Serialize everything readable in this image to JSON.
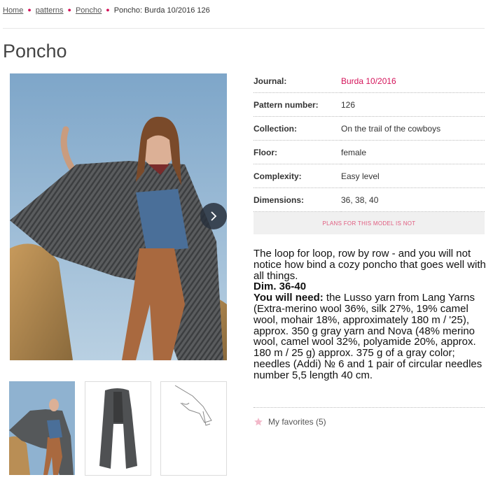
{
  "breadcrumb": {
    "home": "Home",
    "patterns": "patterns",
    "category": "Poncho",
    "current": "Poncho: Burda 10/2016 126"
  },
  "page": {
    "title": "Poncho"
  },
  "details": {
    "journal_label": "Journal:",
    "journal_value": "Burda 10/2016",
    "pattern_label": "Pattern number:",
    "pattern_value": "126",
    "collection_label": "Collection:",
    "collection_value": "On the trail of the cowboys",
    "floor_label": "Floor:",
    "floor_value": "female",
    "complexity_label": "Complexity:",
    "complexity_value": "Easy level",
    "dimensions_label": "Dimensions:",
    "dimensions_value": "36, 38, 40"
  },
  "plans_button": "PLANS FOR THIS MODEL IS NOT",
  "description": {
    "intro": "The loop for loop, row by row - and you will not notice how bind a cozy poncho that goes well with all things.",
    "dim": "Dim. 36-40",
    "need_label": "You will need:",
    "need_text": " the Lusso yarn from Lang Yarns (Extra-merino wool 36%, silk 27%, 19% camel wool, mohair 18%, approximately 180 m / '25), approx. 350 g gray yarn and Nova (48% merino wool, camel wool 32%, polyamide 20%, approx. 180 m / 25 g) approx. 375 g of a gray color; needles (Addi) № 6 and 1 pair of circular needles number 5,5 length 40 cm."
  },
  "favorites": {
    "label": "My favorites (5)"
  },
  "icons": {
    "next": "chevron-right-icon",
    "favorite": "star-icon"
  },
  "colors": {
    "accent": "#d4145a"
  }
}
